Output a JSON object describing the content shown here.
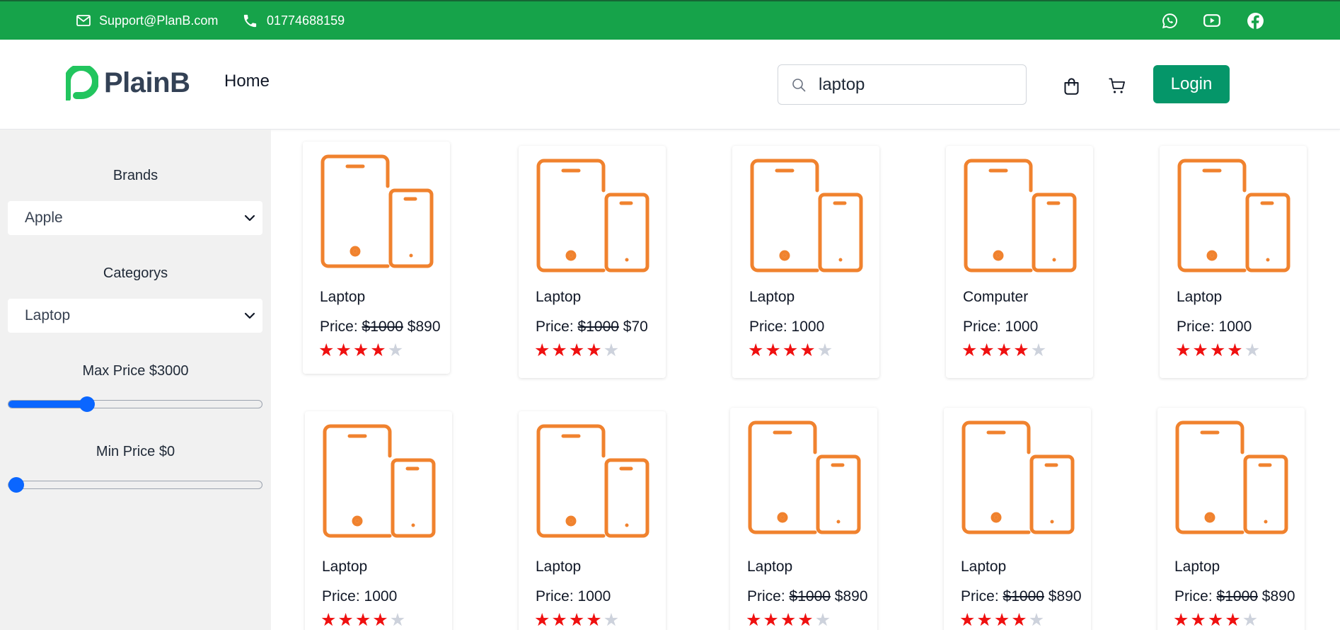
{
  "topbar": {
    "email": "Support@PlanB.com",
    "phone": "01774688159",
    "social_icons": [
      "whatsapp-icon",
      "youtube-icon",
      "facebook-icon"
    ]
  },
  "header": {
    "logo_text": "PlainB",
    "nav_home": "Home",
    "search_value": "laptop",
    "login_label": "Login"
  },
  "filters": {
    "brands_label": "Brands",
    "brand_selected": "Apple",
    "categorys_label": "Categorys",
    "category_selected": "Laptop",
    "max_price_label": "Max Price $3000",
    "max_price_value": 3000,
    "max_price_slider_fraction": 0.31,
    "min_price_label": "Min Price $0",
    "min_price_value": 0,
    "min_price_slider_fraction": 0.0
  },
  "products": [
    {
      "name": "Laptop",
      "price_label": "Price:",
      "old_price": "$1000",
      "price": "$890",
      "rating": 4
    },
    {
      "name": "Laptop",
      "price_label": "Price:",
      "old_price": "$1000",
      "price": "$70",
      "rating": 4
    },
    {
      "name": "Laptop",
      "price_label": "Price:",
      "old_price": "",
      "price": "1000",
      "rating": 4
    },
    {
      "name": "Computer",
      "price_label": "Price:",
      "old_price": "",
      "price": "1000",
      "rating": 4
    },
    {
      "name": "Laptop",
      "price_label": "Price:",
      "old_price": "",
      "price": "1000",
      "rating": 4
    },
    {
      "name": "Laptop",
      "price_label": "Price:",
      "old_price": "",
      "price": "1000",
      "rating": 4
    },
    {
      "name": "Laptop",
      "price_label": "Price:",
      "old_price": "",
      "price": "1000",
      "rating": 4
    },
    {
      "name": "Laptop",
      "price_label": "Price:",
      "old_price": "$1000",
      "price": "$890",
      "rating": 4
    },
    {
      "name": "Laptop",
      "price_label": "Price:",
      "old_price": "$1000",
      "price": "$890",
      "rating": 4
    },
    {
      "name": "Laptop",
      "price_label": "Price:",
      "old_price": "$1000",
      "price": "$890",
      "rating": 4
    }
  ],
  "colors": {
    "topbar": "#16a34a",
    "login_button": "#059669",
    "logo_accent": "#22c55e",
    "device_icon": "#f0822e",
    "star_on": "#ef1010",
    "star_off": "#cdd2dc",
    "slider": "#0a66ff"
  }
}
